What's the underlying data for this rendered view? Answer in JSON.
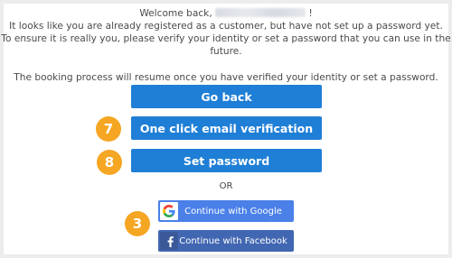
{
  "welcome": {
    "greeting": "Welcome back,",
    "suffix": "!"
  },
  "message": {
    "line1": "It looks like you are already registered as a customer, but have not set up a password yet.",
    "line2": "To ensure it is really you, please verify your identity or set a password that you can use in the future.",
    "resume": "The booking process will resume once you have verified your identity or set a password."
  },
  "buttons": {
    "go_back": "Go back",
    "one_click": "One click email verification",
    "set_password": "Set password"
  },
  "divider": {
    "or": "OR"
  },
  "social": {
    "google": "Continue with Google",
    "facebook": "Continue with Facebook"
  },
  "badges": {
    "one_click": "7",
    "set_password": "8",
    "social": "3"
  },
  "colors": {
    "primary_button": "#1f7fd6",
    "google_button": "#4a80e8",
    "facebook_button": "#4267b2",
    "badge": "#f5a623"
  },
  "icons": {
    "google": "google-g-icon",
    "facebook": "facebook-f-icon"
  }
}
